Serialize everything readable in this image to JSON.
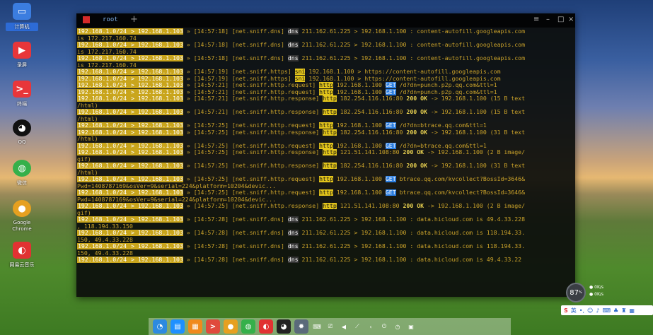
{
  "desktop": {
    "icons": [
      {
        "label": "计算机"
      },
      {
        "label": "录屏"
      },
      {
        "label": "终端"
      },
      {
        "label": "QQ"
      },
      {
        "label": "微信"
      },
      {
        "label": "Google\nChrome"
      },
      {
        "label": "网易云音乐"
      }
    ]
  },
  "terminal": {
    "tab_label": "root",
    "tab_add": "+",
    "controls": {
      "menu": "≡",
      "minimize": "–",
      "maximize": "□",
      "close": "×"
    },
    "lines": [
      {
        "pfx": "192.168.1.0/24",
        "tgt": "192.168.1.103",
        "time": "[14:57:18]",
        "mod": "[net.sniff.dns]",
        "badge": "dns",
        "badge_type": "dns",
        "body": " 211.162.61.225 > 192.168.1.100 : content-autofill.googleapis.com"
      },
      {
        "cont": " is 172.217.160.74"
      },
      {
        "pfx": "192.168.1.0/24",
        "tgt": "192.168.1.103",
        "time": "[14:57:18]",
        "mod": "[net.sniff.dns]",
        "badge": "dns",
        "badge_type": "dns",
        "body": " 211.162.61.225 > 192.168.1.100 : content-autofill.googleapis.com"
      },
      {
        "cont": " is 172.217.160.74"
      },
      {
        "pfx": "192.168.1.0/24",
        "tgt": "192.168.1.103",
        "time": "[14:57:18]",
        "mod": "[net.sniff.dns]",
        "badge": "dns",
        "badge_type": "dns",
        "body": " 211.162.61.225 > 192.168.1.100 : content-autofill.googleapis.com"
      },
      {
        "cont": " is 172.217.160.74"
      },
      {
        "pfx": "192.168.1.0/24",
        "tgt": "192.168.1.103",
        "time": "[14:57:19]",
        "mod": "[net.sniff.https]",
        "badge": "sni",
        "badge_type": "sni",
        "body": " 192.168.1.100 > https://content-autofill.googleapis.com"
      },
      {
        "pfx": "192.168.1.0/24",
        "tgt": "192.168.1.103",
        "time": "[14:57:19]",
        "mod": "[net.sniff.https]",
        "badge": "sni",
        "badge_type": "sni",
        "body": " 192.168.1.100 > https://content-autofill.googleapis.com"
      },
      {
        "pfx": "192.168.1.0/24",
        "tgt": "192.168.1.103",
        "time": "[14:57:21]",
        "mod": "[net.sniff.http.request]",
        "badge": "http",
        "badge_type": "http",
        "body": " 192.168.1.100 ",
        "get": "GET",
        "tail": " /d?dn=punch.p2p.qq.com&ttl=1"
      },
      {
        "pfx": "192.168.1.0/24",
        "tgt": "192.168.1.103",
        "time": "[14:57:21]",
        "mod": "[net.sniff.http.request]",
        "badge": "http",
        "badge_type": "http",
        "body": " 192.168.1.100 ",
        "get": "GET",
        "tail": " /d?dn=punch.p2p.qq.com&ttl=1"
      },
      {
        "pfx": "192.168.1.0/24",
        "tgt": "192.168.1.103",
        "time": "[14:57:21]",
        "mod": "[net.sniff.http.response]",
        "badge": "http",
        "badge_type": "http",
        "body": " 182.254.116.116:80 ",
        "ok": "200 OK",
        "tail": " -> 192.168.1.100 (15 B text"
      },
      {
        "cont": "/html)"
      },
      {
        "pfx": "192.168.1.0/24",
        "tgt": "192.168.1.103",
        "time": "[14:57:21]",
        "mod": "[net.sniff.http.response]",
        "badge": "http",
        "badge_type": "http",
        "body": " 182.254.116.116:80 ",
        "ok": "200 OK",
        "tail": " -> 192.168.1.100 (15 B text"
      },
      {
        "cont": "/html)"
      },
      {
        "pfx": "192.168.1.0/24",
        "tgt": "192.168.1.103",
        "time": "[14:57:25]",
        "mod": "[net.sniff.http.request]",
        "badge": "http",
        "badge_type": "http",
        "body": " 192.168.1.100 ",
        "get": "GET",
        "tail": " /d?dn=btrace.qq.com&ttl=1"
      },
      {
        "pfx": "192.168.1.0/24",
        "tgt": "192.168.1.103",
        "time": "[14:57:25]",
        "mod": "[net.sniff.http.response]",
        "badge": "http",
        "badge_type": "http",
        "body": " 182.254.116.116:80 ",
        "ok": "200 OK",
        "tail": " -> 192.168.1.100 (31 B text"
      },
      {
        "cont": "/html)"
      },
      {
        "pfx": "192.168.1.0/24",
        "tgt": "192.168.1.103",
        "time": "[14:57:25]",
        "mod": "[net.sniff.http.request]",
        "badge": "http",
        "badge_type": "http",
        "body": " 192.168.1.100 ",
        "get": "GET",
        "tail": " /d?dn=btrace.qq.com&ttl=1"
      },
      {
        "pfx": "192.168.1.0/24",
        "tgt": "192.168.1.103",
        "time": "[14:57:25]",
        "mod": "[net.sniff.http.response]",
        "badge": "http",
        "badge_type": "http",
        "body": " 121.51.141.108:80 ",
        "ok": "200 OK",
        "tail": " -> 192.168.1.100 (2 B image/"
      },
      {
        "cont": "gif)"
      },
      {
        "pfx": "192.168.1.0/24",
        "tgt": "192.168.1.103",
        "time": "[14:57:25]",
        "mod": "[net.sniff.http.response]",
        "badge": "http",
        "badge_type": "http",
        "body": " 182.254.116.116:80 ",
        "ok": "200 OK",
        "tail": " -> 192.168.1.100 (31 B text"
      },
      {
        "cont": "/html)"
      },
      {
        "pfx": "192.168.1.0/24",
        "tgt": "192.168.1.103",
        "time": "[14:57:25]",
        "mod": "[net.sniff.http.request]",
        "badge": "http",
        "badge_type": "http",
        "body": " 192.168.1.100 ",
        "get": "GET",
        "tail": " btrace.qq.com/kvcollect?BossId=3646&"
      },
      {
        "cont": "Pwd=1408787169&osVer=9&serial=224&platform=10204&devic..."
      },
      {
        "pfx": "192.168.1.0/24",
        "tgt": "192.168.1.103",
        "time": "[14:57:25]",
        "mod": "[net.sniff.http.request]",
        "badge": "http",
        "badge_type": "http",
        "body": " 192.168.1.100 ",
        "get": "GET",
        "tail": " btrace.qq.com/kvcollect?BossId=3646&"
      },
      {
        "cont": "Pwd=1408787169&osVer=9&serial=224&platform=10204&devic..."
      },
      {
        "pfx": "192.168.1.0/24",
        "tgt": "192.168.1.103",
        "time": "[14:57:25]",
        "mod": "[net.sniff.http.response]",
        "badge": "http",
        "badge_type": "http",
        "body": " 121.51.141.108:80 ",
        "ok": "200 OK",
        "tail": " -> 192.168.1.100 (2 B image/"
      },
      {
        "cont": "gif)"
      },
      {
        "pfx": "192.168.1.0/24",
        "tgt": "192.168.1.103",
        "time": "[14:57:28]",
        "mod": "[net.sniff.dns]",
        "badge": "dns",
        "badge_type": "dns",
        "body": " 211.162.61.225 > 192.168.1.100 : data.hicloud.com is 49.4.33.228"
      },
      {
        "cont": ", 118.194.33.150"
      },
      {
        "pfx": "192.168.1.0/24",
        "tgt": "192.168.1.103",
        "time": "[14:57:28]",
        "mod": "[net.sniff.dns]",
        "badge": "dns",
        "badge_type": "dns",
        "body": " 211.162.61.225 > 192.168.1.100 : data.hicloud.com is 118.194.33."
      },
      {
        "cont": "150, 49.4.33.228"
      },
      {
        "pfx": "192.168.1.0/24",
        "tgt": "192.168.1.103",
        "time": "[14:57:28]",
        "mod": "[net.sniff.dns]",
        "badge": "dns",
        "badge_type": "dns",
        "body": " 211.162.61.225 > 192.168.1.100 : data.hicloud.com is 118.194.33."
      },
      {
        "cont": "150, 49.4.33.228"
      },
      {
        "pfx": "192.168.1.0/24",
        "tgt": "192.168.1.103",
        "time": "[14:57:28]",
        "mod": "[net.sniff.dns]",
        "badge": "dns",
        "badge_type": "dns",
        "body": " 211.162.61.225 > 192.168.1.100 : data.hicloud.com is 49.4.33.22"
      }
    ]
  },
  "widgets": {
    "cpu_percent": "87",
    "cpu_unit": "%",
    "net_up": "0K/s",
    "net_down": "0K/s",
    "ime_label": "英"
  },
  "dock": {
    "items": [
      {
        "name": "launcher",
        "color": "#2d8ae0",
        "glyph": "◔"
      },
      {
        "name": "file-manager",
        "color": "#1e90ff",
        "glyph": "▤"
      },
      {
        "name": "store",
        "color": "#f08a1c",
        "glyph": "▦"
      },
      {
        "name": "terminal",
        "color": "#e04a3c",
        "glyph": ">"
      },
      {
        "name": "chrome",
        "color": "#e6a020",
        "glyph": "●"
      },
      {
        "name": "wechat",
        "color": "#35b04a",
        "glyph": "◍"
      },
      {
        "name": "netease-music",
        "color": "#e13232",
        "glyph": "◐"
      },
      {
        "name": "qq",
        "color": "#222222",
        "glyph": "◕"
      },
      {
        "name": "settings",
        "color": "#5a6a7a",
        "glyph": "✹"
      }
    ],
    "tray": [
      "⌨",
      "⎚",
      "◀",
      "⟋",
      "‹",
      "⏻",
      "◷",
      "▣"
    ]
  }
}
